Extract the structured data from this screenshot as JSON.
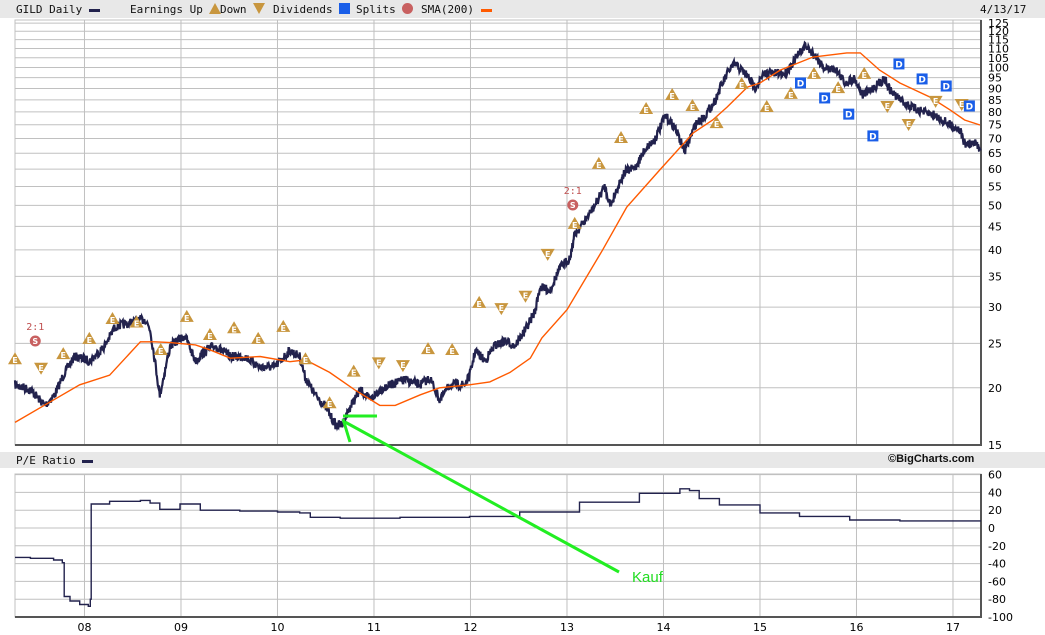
{
  "header": {
    "symbol_label": "GILD Daily",
    "earnings_label": "Earnings Up",
    "down_label": "Down",
    "dividends_label": "Dividends",
    "splits_label": "Splits",
    "sma_label": "SMA(200)",
    "date": "4/13/17"
  },
  "lower_header": {
    "pe_label": "P/E Ratio",
    "brand": "©BigCharts.com"
  },
  "colors": {
    "price": "#22224d",
    "sma": "#ff5a00",
    "earnings": "#c8963e",
    "dividend": "#1a5ee8",
    "split": "#c86060",
    "annotation": "#22ee22",
    "grid": "#c0c0c0"
  },
  "annotation": {
    "text": "Kauf"
  },
  "icons": {
    "earnings_up": "triangle-up-E",
    "earnings_down": "triangle-down-E",
    "dividend": "square-D",
    "split": "circle-S"
  },
  "chart_data": [
    {
      "type": "line",
      "title": "GILD Daily",
      "yscale": "log",
      "ylim": [
        15,
        125
      ],
      "xlim": [
        2007.28,
        2017.29
      ],
      "grid": true,
      "y_ticks": [
        15,
        20,
        25,
        30,
        35,
        40,
        45,
        50,
        55,
        60,
        65,
        70,
        75,
        80,
        85,
        90,
        95,
        100,
        105,
        110,
        115,
        120,
        125
      ],
      "x_ticks": [
        {
          "t": 2008,
          "label": "08"
        },
        {
          "t": 2009,
          "label": "09"
        },
        {
          "t": 2010,
          "label": "10"
        },
        {
          "t": 2011,
          "label": "11"
        },
        {
          "t": 2012,
          "label": "12"
        },
        {
          "t": 2013,
          "label": "13"
        },
        {
          "t": 2014,
          "label": "14"
        },
        {
          "t": 2015,
          "label": "15"
        },
        {
          "t": 2016,
          "label": "16"
        },
        {
          "t": 2017,
          "label": "17"
        }
      ],
      "series": [
        {
          "name": "GILD Daily",
          "points": [
            [
              2007.28,
              20.3
            ],
            [
              2007.44,
              19.8
            ],
            [
              2007.59,
              18.3
            ],
            [
              2007.69,
              19.3
            ],
            [
              2007.8,
              21.7
            ],
            [
              2007.9,
              23.4
            ],
            [
              2008.06,
              22.9
            ],
            [
              2008.21,
              24.7
            ],
            [
              2008.32,
              27.2
            ],
            [
              2008.47,
              27.7
            ],
            [
              2008.63,
              28.2
            ],
            [
              2008.68,
              26.8
            ],
            [
              2008.73,
              22.9
            ],
            [
              2008.78,
              19.3
            ],
            [
              2008.89,
              24.7
            ],
            [
              2009.04,
              26.0
            ],
            [
              2009.15,
              22.9
            ],
            [
              2009.25,
              24.1
            ],
            [
              2009.35,
              24.7
            ],
            [
              2009.51,
              23.4
            ],
            [
              2009.66,
              23.4
            ],
            [
              2009.82,
              22.2
            ],
            [
              2009.97,
              22.2
            ],
            [
              2010.13,
              24.1
            ],
            [
              2010.23,
              23.4
            ],
            [
              2010.29,
              21.0
            ],
            [
              2010.39,
              19.3
            ],
            [
              2010.49,
              18.3
            ],
            [
              2010.6,
              16.6
            ],
            [
              2010.67,
              16.6
            ],
            [
              2010.75,
              18.1
            ],
            [
              2010.86,
              19.8
            ],
            [
              2010.96,
              18.8
            ],
            [
              2011.06,
              19.8
            ],
            [
              2011.22,
              20.5
            ],
            [
              2011.32,
              20.8
            ],
            [
              2011.48,
              20.3
            ],
            [
              2011.58,
              21.0
            ],
            [
              2011.68,
              18.8
            ],
            [
              2011.79,
              20.3
            ],
            [
              2011.94,
              20.3
            ],
            [
              2011.99,
              21.2
            ],
            [
              2012.05,
              24.1
            ],
            [
              2012.15,
              22.9
            ],
            [
              2012.25,
              24.7
            ],
            [
              2012.36,
              25.3
            ],
            [
              2012.46,
              24.7
            ],
            [
              2012.57,
              26.8
            ],
            [
              2012.67,
              29.4
            ],
            [
              2012.72,
              33.2
            ],
            [
              2012.82,
              32.6
            ],
            [
              2012.93,
              36.6
            ],
            [
              2013.03,
              38.4
            ],
            [
              2013.08,
              43.2
            ],
            [
              2013.19,
              46.4
            ],
            [
              2013.29,
              50.0
            ],
            [
              2013.39,
              55.1
            ],
            [
              2013.45,
              50.0
            ],
            [
              2013.55,
              56.4
            ],
            [
              2013.6,
              59.1
            ],
            [
              2013.71,
              60.6
            ],
            [
              2013.81,
              66.4
            ],
            [
              2013.91,
              69.7
            ],
            [
              2014.02,
              78.4
            ],
            [
              2014.12,
              74.0
            ],
            [
              2014.22,
              65.5
            ],
            [
              2014.33,
              75.1
            ],
            [
              2014.43,
              78.4
            ],
            [
              2014.53,
              84.3
            ],
            [
              2014.59,
              90.5
            ],
            [
              2014.69,
              99.4
            ],
            [
              2014.74,
              101.7
            ],
            [
              2014.85,
              97.0
            ],
            [
              2014.95,
              90.5
            ],
            [
              2015.05,
              97.0
            ],
            [
              2015.16,
              97.0
            ],
            [
              2015.26,
              97.0
            ],
            [
              2015.36,
              104.0
            ],
            [
              2015.47,
              111.5
            ],
            [
              2015.57,
              106.4
            ],
            [
              2015.67,
              99.4
            ],
            [
              2015.78,
              99.4
            ],
            [
              2015.88,
              92.6
            ],
            [
              2015.98,
              94.7
            ],
            [
              2016.06,
              87.2
            ],
            [
              2016.14,
              89.1
            ],
            [
              2016.24,
              92.6
            ],
            [
              2016.29,
              94.7
            ],
            [
              2016.35,
              89.1
            ],
            [
              2016.45,
              85.2
            ],
            [
              2016.55,
              82.3
            ],
            [
              2016.66,
              80.4
            ],
            [
              2016.81,
              78.7
            ],
            [
              2016.97,
              75.0
            ],
            [
              2017.07,
              73.4
            ],
            [
              2017.12,
              68.1
            ],
            [
              2017.23,
              68.1
            ],
            [
              2017.29,
              66.8
            ]
          ]
        },
        {
          "name": "SMA(200)",
          "points": [
            [
              2007.28,
              16.8
            ],
            [
              2007.64,
              18.6
            ],
            [
              2007.95,
              20.3
            ],
            [
              2008.26,
              21.3
            ],
            [
              2008.58,
              25.2
            ],
            [
              2008.73,
              25.2
            ],
            [
              2008.89,
              25.1
            ],
            [
              2009.15,
              24.8
            ],
            [
              2009.3,
              24.2
            ],
            [
              2009.51,
              23.2
            ],
            [
              2009.82,
              23.4
            ],
            [
              2010.13,
              22.8
            ],
            [
              2010.29,
              23.0
            ],
            [
              2010.54,
              21.6
            ],
            [
              2010.8,
              19.8
            ],
            [
              2011.06,
              18.3
            ],
            [
              2011.22,
              18.3
            ],
            [
              2011.48,
              19.3
            ],
            [
              2011.68,
              20.0
            ],
            [
              2011.99,
              20.3
            ],
            [
              2012.2,
              20.6
            ],
            [
              2012.41,
              21.6
            ],
            [
              2012.62,
              23.2
            ],
            [
              2012.74,
              25.7
            ],
            [
              2013.0,
              29.6
            ],
            [
              2013.37,
              40.0
            ],
            [
              2013.62,
              49.6
            ],
            [
              2013.96,
              59.7
            ],
            [
              2014.31,
              72.0
            ],
            [
              2014.51,
              76.8
            ],
            [
              2014.66,
              82.0
            ],
            [
              2014.87,
              90.6
            ],
            [
              2015.0,
              92.5
            ],
            [
              2015.21,
              98.7
            ],
            [
              2015.55,
              105.4
            ],
            [
              2015.9,
              107.6
            ],
            [
              2016.04,
              107.6
            ],
            [
              2016.24,
              98.7
            ],
            [
              2016.45,
              92.5
            ],
            [
              2016.76,
              86.2
            ],
            [
              2016.97,
              80.8
            ],
            [
              2017.12,
              76.8
            ],
            [
              2017.28,
              74.9
            ]
          ]
        }
      ],
      "events": {
        "earnings_up": [
          [
            2007.28,
            23.2
          ],
          [
            2007.78,
            23.8
          ],
          [
            2008.05,
            25.7
          ],
          [
            2008.29,
            28.4
          ],
          [
            2008.54,
            27.9
          ],
          [
            2008.79,
            24.3
          ],
          [
            2009.06,
            28.7
          ],
          [
            2009.3,
            26.2
          ],
          [
            2009.55,
            27.1
          ],
          [
            2009.8,
            25.7
          ],
          [
            2010.06,
            27.3
          ],
          [
            2010.29,
            23.2
          ],
          [
            2010.54,
            18.6
          ],
          [
            2010.79,
            21.8
          ],
          [
            2011.56,
            24.4
          ],
          [
            2011.81,
            24.3
          ],
          [
            2012.09,
            30.8
          ],
          [
            2013.08,
            45.8
          ],
          [
            2013.33,
            61.9
          ],
          [
            2013.56,
            70.5
          ],
          [
            2013.82,
            81.6
          ],
          [
            2014.09,
            87.5
          ],
          [
            2014.3,
            82.8
          ],
          [
            2014.55,
            76.0
          ],
          [
            2014.81,
            92.5
          ],
          [
            2015.07,
            82.4
          ],
          [
            2015.32,
            88.0
          ],
          [
            2015.56,
            97.3
          ],
          [
            2015.81,
            90.6
          ],
          [
            2016.08,
            97.3
          ]
        ],
        "earnings_down": [
          [
            2007.55,
            22.0
          ],
          [
            2011.05,
            22.6
          ],
          [
            2011.3,
            22.3
          ],
          [
            2012.32,
            29.7
          ],
          [
            2012.57,
            31.6
          ],
          [
            2012.8,
            39.0
          ],
          [
            2016.32,
            82.0
          ],
          [
            2016.54,
            74.9
          ],
          [
            2016.82,
            84.1
          ],
          [
            2017.09,
            82.8
          ]
        ],
        "dividends": [
          [
            2015.42,
            92.5
          ],
          [
            2015.67,
            85.8
          ],
          [
            2015.92,
            79.1
          ],
          [
            2016.17,
            70.9
          ],
          [
            2016.44,
            101.8
          ],
          [
            2016.68,
            94.4
          ],
          [
            2016.93,
            91.1
          ],
          [
            2017.17,
            82.4
          ]
        ],
        "splits": [
          {
            "t": 2007.49,
            "p": 25.3,
            "label": "2:1"
          },
          {
            "t": 2013.06,
            "p": 50.1,
            "label": "2:1"
          }
        ]
      }
    },
    {
      "type": "line",
      "title": "P/E Ratio",
      "ylim": [
        -100,
        60
      ],
      "grid": true,
      "y_ticks": [
        60,
        40,
        20,
        0,
        -20,
        -40,
        -60,
        -80,
        -100
      ],
      "series": [
        {
          "name": "P/E Ratio",
          "points": [
            [
              2007.28,
              -33
            ],
            [
              2007.44,
              -34
            ],
            [
              2007.68,
              -36
            ],
            [
              2007.77,
              -39
            ],
            [
              2007.79,
              -77
            ],
            [
              2007.85,
              -82
            ],
            [
              2007.95,
              -86
            ],
            [
              2008.04,
              -88
            ],
            [
              2008.06,
              -80
            ],
            [
              2008.07,
              27
            ],
            [
              2008.26,
              30
            ],
            [
              2008.58,
              31
            ],
            [
              2008.68,
              28
            ],
            [
              2008.78,
              21
            ],
            [
              2008.99,
              27
            ],
            [
              2009.2,
              20
            ],
            [
              2009.61,
              19
            ],
            [
              2010.0,
              18
            ],
            [
              2010.23,
              17
            ],
            [
              2010.34,
              12
            ],
            [
              2010.65,
              11
            ],
            [
              2011.27,
              12
            ],
            [
              2011.99,
              13
            ],
            [
              2012.51,
              18
            ],
            [
              2013.13,
              29
            ],
            [
              2013.75,
              39
            ],
            [
              2014.17,
              44
            ],
            [
              2014.27,
              42
            ],
            [
              2014.37,
              33
            ],
            [
              2014.58,
              26
            ],
            [
              2015.0,
              17
            ],
            [
              2015.41,
              13
            ],
            [
              2015.93,
              9
            ],
            [
              2016.45,
              8
            ],
            [
              2017.29,
              8
            ]
          ]
        }
      ]
    }
  ]
}
